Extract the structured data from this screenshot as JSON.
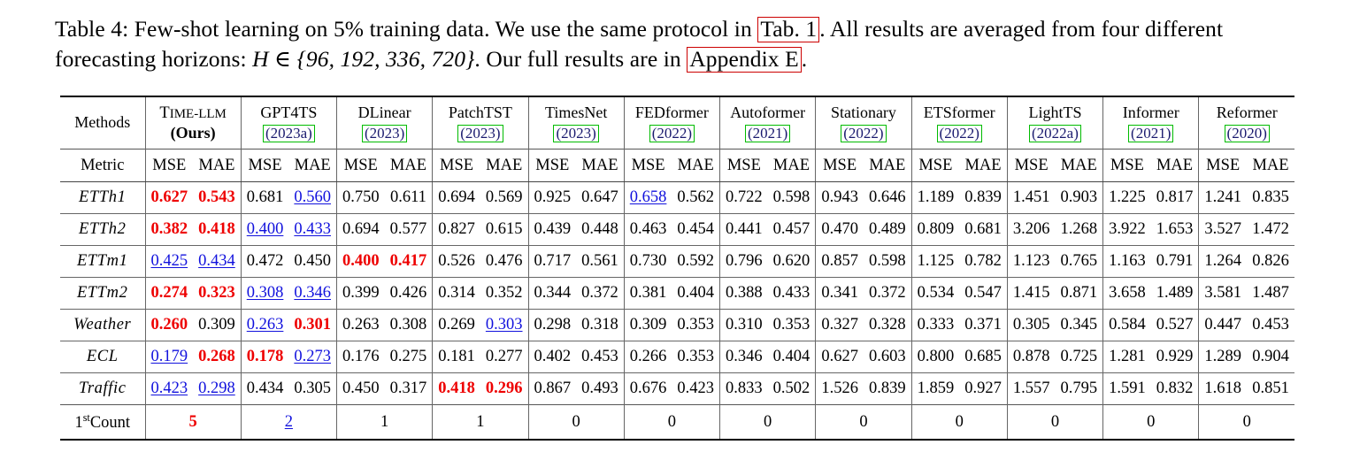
{
  "caption": {
    "line1_a": "Table 4: Few-shot learning on 5% training data. We use the same protocol in ",
    "link1": "Tab. 1",
    "line1_b": ". All results are averaged",
    "line2_a": "from four different forecasting horizons: ",
    "math": "H ∈ {96, 192, 336, 720}",
    "line2_b": ". Our full results are in ",
    "link2": "Appendix E",
    "line2_c": "."
  },
  "table": {
    "corner_label": "Methods",
    "metric_label": "Metric",
    "metric_mse": "MSE",
    "metric_mae": "MAE",
    "colors": {
      "best": "#ee0000",
      "second": "#1111dd",
      "year_box": "#00bb00",
      "link_box": "#cc0000"
    },
    "methods": [
      {
        "name_prefix": "T",
        "name_rest": "IME-LLM",
        "smallcaps": true,
        "sub": "(Ours)",
        "sub_bold": true,
        "year": null
      },
      {
        "name_prefix": "",
        "name_rest": "GPT4TS",
        "smallcaps": false,
        "sub": null,
        "sub_bold": false,
        "year": "(2023a)"
      },
      {
        "name_prefix": "",
        "name_rest": "DLinear",
        "smallcaps": false,
        "sub": null,
        "sub_bold": false,
        "year": "(2023)"
      },
      {
        "name_prefix": "",
        "name_rest": "PatchTST",
        "smallcaps": false,
        "sub": null,
        "sub_bold": false,
        "year": "(2023)"
      },
      {
        "name_prefix": "",
        "name_rest": "TimesNet",
        "smallcaps": false,
        "sub": null,
        "sub_bold": false,
        "year": "(2023)"
      },
      {
        "name_prefix": "",
        "name_rest": "FEDformer",
        "smallcaps": false,
        "sub": null,
        "sub_bold": false,
        "year": "(2022)"
      },
      {
        "name_prefix": "",
        "name_rest": "Autoformer",
        "smallcaps": false,
        "sub": null,
        "sub_bold": false,
        "year": "(2021)"
      },
      {
        "name_prefix": "",
        "name_rest": "Stationary",
        "smallcaps": false,
        "sub": null,
        "sub_bold": false,
        "year": "(2022)"
      },
      {
        "name_prefix": "",
        "name_rest": "ETSformer",
        "smallcaps": false,
        "sub": null,
        "sub_bold": false,
        "year": "(2022)"
      },
      {
        "name_prefix": "",
        "name_rest": "LightTS",
        "smallcaps": false,
        "sub": null,
        "sub_bold": false,
        "year": "(2022a)"
      },
      {
        "name_prefix": "",
        "name_rest": "Informer",
        "smallcaps": false,
        "sub": null,
        "sub_bold": false,
        "year": "(2021)"
      },
      {
        "name_prefix": "",
        "name_rest": "Reformer",
        "smallcaps": false,
        "sub": null,
        "sub_bold": false,
        "year": "(2020)"
      }
    ],
    "rows": [
      {
        "label": "ETTh1",
        "italic": true,
        "cells": [
          {
            "v": "0.627",
            "s": "best"
          },
          {
            "v": "0.543",
            "s": "best"
          },
          {
            "v": "0.681",
            "s": ""
          },
          {
            "v": "0.560",
            "s": "second"
          },
          {
            "v": "0.750",
            "s": ""
          },
          {
            "v": "0.611",
            "s": ""
          },
          {
            "v": "0.694",
            "s": ""
          },
          {
            "v": "0.569",
            "s": ""
          },
          {
            "v": "0.925",
            "s": ""
          },
          {
            "v": "0.647",
            "s": ""
          },
          {
            "v": "0.658",
            "s": "second"
          },
          {
            "v": "0.562",
            "s": ""
          },
          {
            "v": "0.722",
            "s": ""
          },
          {
            "v": "0.598",
            "s": ""
          },
          {
            "v": "0.943",
            "s": ""
          },
          {
            "v": "0.646",
            "s": ""
          },
          {
            "v": "1.189",
            "s": ""
          },
          {
            "v": "0.839",
            "s": ""
          },
          {
            "v": "1.451",
            "s": ""
          },
          {
            "v": "0.903",
            "s": ""
          },
          {
            "v": "1.225",
            "s": ""
          },
          {
            "v": "0.817",
            "s": ""
          },
          {
            "v": "1.241",
            "s": ""
          },
          {
            "v": "0.835",
            "s": ""
          }
        ]
      },
      {
        "label": "ETTh2",
        "italic": true,
        "cells": [
          {
            "v": "0.382",
            "s": "best"
          },
          {
            "v": "0.418",
            "s": "best"
          },
          {
            "v": "0.400",
            "s": "second"
          },
          {
            "v": "0.433",
            "s": "second"
          },
          {
            "v": "0.694",
            "s": ""
          },
          {
            "v": "0.577",
            "s": ""
          },
          {
            "v": "0.827",
            "s": ""
          },
          {
            "v": "0.615",
            "s": ""
          },
          {
            "v": "0.439",
            "s": ""
          },
          {
            "v": "0.448",
            "s": ""
          },
          {
            "v": "0.463",
            "s": ""
          },
          {
            "v": "0.454",
            "s": ""
          },
          {
            "v": "0.441",
            "s": ""
          },
          {
            "v": "0.457",
            "s": ""
          },
          {
            "v": "0.470",
            "s": ""
          },
          {
            "v": "0.489",
            "s": ""
          },
          {
            "v": "0.809",
            "s": ""
          },
          {
            "v": "0.681",
            "s": ""
          },
          {
            "v": "3.206",
            "s": ""
          },
          {
            "v": "1.268",
            "s": ""
          },
          {
            "v": "3.922",
            "s": ""
          },
          {
            "v": "1.653",
            "s": ""
          },
          {
            "v": "3.527",
            "s": ""
          },
          {
            "v": "1.472",
            "s": ""
          }
        ]
      },
      {
        "label": "ETTm1",
        "italic": true,
        "cells": [
          {
            "v": "0.425",
            "s": "second"
          },
          {
            "v": "0.434",
            "s": "second"
          },
          {
            "v": "0.472",
            "s": ""
          },
          {
            "v": "0.450",
            "s": ""
          },
          {
            "v": "0.400",
            "s": "best"
          },
          {
            "v": "0.417",
            "s": "best"
          },
          {
            "v": "0.526",
            "s": ""
          },
          {
            "v": "0.476",
            "s": ""
          },
          {
            "v": "0.717",
            "s": ""
          },
          {
            "v": "0.561",
            "s": ""
          },
          {
            "v": "0.730",
            "s": ""
          },
          {
            "v": "0.592",
            "s": ""
          },
          {
            "v": "0.796",
            "s": ""
          },
          {
            "v": "0.620",
            "s": ""
          },
          {
            "v": "0.857",
            "s": ""
          },
          {
            "v": "0.598",
            "s": ""
          },
          {
            "v": "1.125",
            "s": ""
          },
          {
            "v": "0.782",
            "s": ""
          },
          {
            "v": "1.123",
            "s": ""
          },
          {
            "v": "0.765",
            "s": ""
          },
          {
            "v": "1.163",
            "s": ""
          },
          {
            "v": "0.791",
            "s": ""
          },
          {
            "v": "1.264",
            "s": ""
          },
          {
            "v": "0.826",
            "s": ""
          }
        ]
      },
      {
        "label": "ETTm2",
        "italic": true,
        "cells": [
          {
            "v": "0.274",
            "s": "best"
          },
          {
            "v": "0.323",
            "s": "best"
          },
          {
            "v": "0.308",
            "s": "second"
          },
          {
            "v": "0.346",
            "s": "second"
          },
          {
            "v": "0.399",
            "s": ""
          },
          {
            "v": "0.426",
            "s": ""
          },
          {
            "v": "0.314",
            "s": ""
          },
          {
            "v": "0.352",
            "s": ""
          },
          {
            "v": "0.344",
            "s": ""
          },
          {
            "v": "0.372",
            "s": ""
          },
          {
            "v": "0.381",
            "s": ""
          },
          {
            "v": "0.404",
            "s": ""
          },
          {
            "v": "0.388",
            "s": ""
          },
          {
            "v": "0.433",
            "s": ""
          },
          {
            "v": "0.341",
            "s": ""
          },
          {
            "v": "0.372",
            "s": ""
          },
          {
            "v": "0.534",
            "s": ""
          },
          {
            "v": "0.547",
            "s": ""
          },
          {
            "v": "1.415",
            "s": ""
          },
          {
            "v": "0.871",
            "s": ""
          },
          {
            "v": "3.658",
            "s": ""
          },
          {
            "v": "1.489",
            "s": ""
          },
          {
            "v": "3.581",
            "s": ""
          },
          {
            "v": "1.487",
            "s": ""
          }
        ]
      },
      {
        "label": "Weather",
        "italic": true,
        "cells": [
          {
            "v": "0.260",
            "s": "best"
          },
          {
            "v": "0.309",
            "s": ""
          },
          {
            "v": "0.263",
            "s": "second"
          },
          {
            "v": "0.301",
            "s": "best"
          },
          {
            "v": "0.263",
            "s": ""
          },
          {
            "v": "0.308",
            "s": ""
          },
          {
            "v": "0.269",
            "s": ""
          },
          {
            "v": "0.303",
            "s": "second"
          },
          {
            "v": "0.298",
            "s": ""
          },
          {
            "v": "0.318",
            "s": ""
          },
          {
            "v": "0.309",
            "s": ""
          },
          {
            "v": "0.353",
            "s": ""
          },
          {
            "v": "0.310",
            "s": ""
          },
          {
            "v": "0.353",
            "s": ""
          },
          {
            "v": "0.327",
            "s": ""
          },
          {
            "v": "0.328",
            "s": ""
          },
          {
            "v": "0.333",
            "s": ""
          },
          {
            "v": "0.371",
            "s": ""
          },
          {
            "v": "0.305",
            "s": ""
          },
          {
            "v": "0.345",
            "s": ""
          },
          {
            "v": "0.584",
            "s": ""
          },
          {
            "v": "0.527",
            "s": ""
          },
          {
            "v": "0.447",
            "s": ""
          },
          {
            "v": "0.453",
            "s": ""
          }
        ]
      },
      {
        "label": "ECL",
        "italic": true,
        "cells": [
          {
            "v": "0.179",
            "s": "second"
          },
          {
            "v": "0.268",
            "s": "best"
          },
          {
            "v": "0.178",
            "s": "best"
          },
          {
            "v": "0.273",
            "s": "second"
          },
          {
            "v": "0.176",
            "s": ""
          },
          {
            "v": "0.275",
            "s": ""
          },
          {
            "v": "0.181",
            "s": ""
          },
          {
            "v": "0.277",
            "s": ""
          },
          {
            "v": "0.402",
            "s": ""
          },
          {
            "v": "0.453",
            "s": ""
          },
          {
            "v": "0.266",
            "s": ""
          },
          {
            "v": "0.353",
            "s": ""
          },
          {
            "v": "0.346",
            "s": ""
          },
          {
            "v": "0.404",
            "s": ""
          },
          {
            "v": "0.627",
            "s": ""
          },
          {
            "v": "0.603",
            "s": ""
          },
          {
            "v": "0.800",
            "s": ""
          },
          {
            "v": "0.685",
            "s": ""
          },
          {
            "v": "0.878",
            "s": ""
          },
          {
            "v": "0.725",
            "s": ""
          },
          {
            "v": "1.281",
            "s": ""
          },
          {
            "v": "0.929",
            "s": ""
          },
          {
            "v": "1.289",
            "s": ""
          },
          {
            "v": "0.904",
            "s": ""
          }
        ]
      },
      {
        "label": "Traffic",
        "italic": true,
        "cells": [
          {
            "v": "0.423",
            "s": "second"
          },
          {
            "v": "0.298",
            "s": "second"
          },
          {
            "v": "0.434",
            "s": ""
          },
          {
            "v": "0.305",
            "s": ""
          },
          {
            "v": "0.450",
            "s": ""
          },
          {
            "v": "0.317",
            "s": ""
          },
          {
            "v": "0.418",
            "s": "best"
          },
          {
            "v": "0.296",
            "s": "best"
          },
          {
            "v": "0.867",
            "s": ""
          },
          {
            "v": "0.493",
            "s": ""
          },
          {
            "v": "0.676",
            "s": ""
          },
          {
            "v": "0.423",
            "s": ""
          },
          {
            "v": "0.833",
            "s": ""
          },
          {
            "v": "0.502",
            "s": ""
          },
          {
            "v": "1.526",
            "s": ""
          },
          {
            "v": "0.839",
            "s": ""
          },
          {
            "v": "1.859",
            "s": ""
          },
          {
            "v": "0.927",
            "s": ""
          },
          {
            "v": "1.557",
            "s": ""
          },
          {
            "v": "0.795",
            "s": ""
          },
          {
            "v": "1.591",
            "s": ""
          },
          {
            "v": "0.832",
            "s": ""
          },
          {
            "v": "1.618",
            "s": ""
          },
          {
            "v": "0.851",
            "s": ""
          }
        ]
      }
    ],
    "count_row": {
      "label_num": "1",
      "label_ord": "st",
      "label_word": "Count",
      "counts": [
        {
          "v": "5",
          "s": "best"
        },
        {
          "v": "2",
          "s": "second"
        },
        {
          "v": "1",
          "s": ""
        },
        {
          "v": "1",
          "s": ""
        },
        {
          "v": "0",
          "s": ""
        },
        {
          "v": "0",
          "s": ""
        },
        {
          "v": "0",
          "s": ""
        },
        {
          "v": "0",
          "s": ""
        },
        {
          "v": "0",
          "s": ""
        },
        {
          "v": "0",
          "s": ""
        },
        {
          "v": "0",
          "s": ""
        },
        {
          "v": "0",
          "s": ""
        }
      ]
    }
  }
}
